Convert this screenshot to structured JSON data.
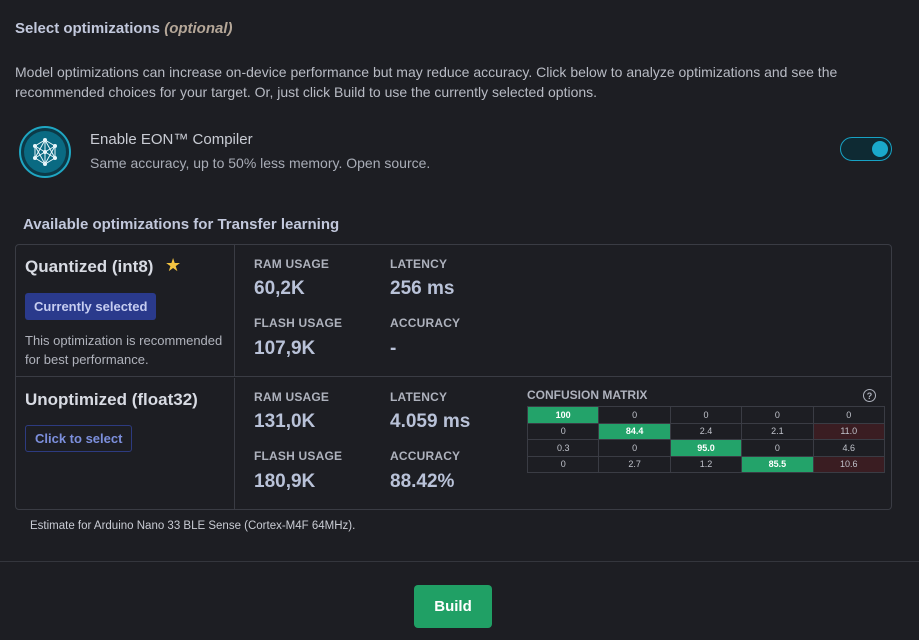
{
  "header": {
    "title": "Select optimizations",
    "optional": "(optional)"
  },
  "description": "Model optimizations can increase on-device performance but may reduce accuracy. Click below to analyze optimizations and see the recommended choices for your target. Or, just click Build to use the currently selected options.",
  "eon": {
    "icon": "neural-network-icon",
    "title": "Enable EON™ Compiler",
    "subtitle": "Same accuracy, up to 50% less memory. Open source.",
    "enabled": true
  },
  "available_title": "Available optimizations for Transfer learning",
  "labels": {
    "ram": "RAM USAGE",
    "latency": "LATENCY",
    "flash": "FLASH USAGE",
    "accuracy": "ACCURACY",
    "confusion": "CONFUSION MATRIX"
  },
  "optimizations": [
    {
      "name": "Quantized (int8)",
      "recommended_icon": "star-icon",
      "button": "Currently selected",
      "note": "This optimization is recommended for best performance.",
      "ram": "60,2K",
      "latency": "256 ms",
      "flash": "107,9K",
      "accuracy": "-"
    },
    {
      "name": "Unoptimized (float32)",
      "button": "Click to select",
      "ram": "131,0K",
      "latency": "4.059 ms",
      "flash": "180,9K",
      "accuracy": "88.42%",
      "confusion_matrix": [
        [
          "100",
          "0",
          "0",
          "0",
          "0"
        ],
        [
          "0",
          "84.4",
          "2.4",
          "2.1",
          "11.0"
        ],
        [
          "0.3",
          "0",
          "95.0",
          "0",
          "4.6"
        ],
        [
          "0",
          "2.7",
          "1.2",
          "85.5",
          "10.6"
        ]
      ]
    }
  ],
  "estimate": "Estimate for Arduino Nano 33 BLE Sense (Cortex-M4F 64MHz).",
  "build_label": "Build",
  "colors": {
    "accent": "#20a065",
    "toggle": "#1aa9cb",
    "selected": "#2a3a8c"
  }
}
